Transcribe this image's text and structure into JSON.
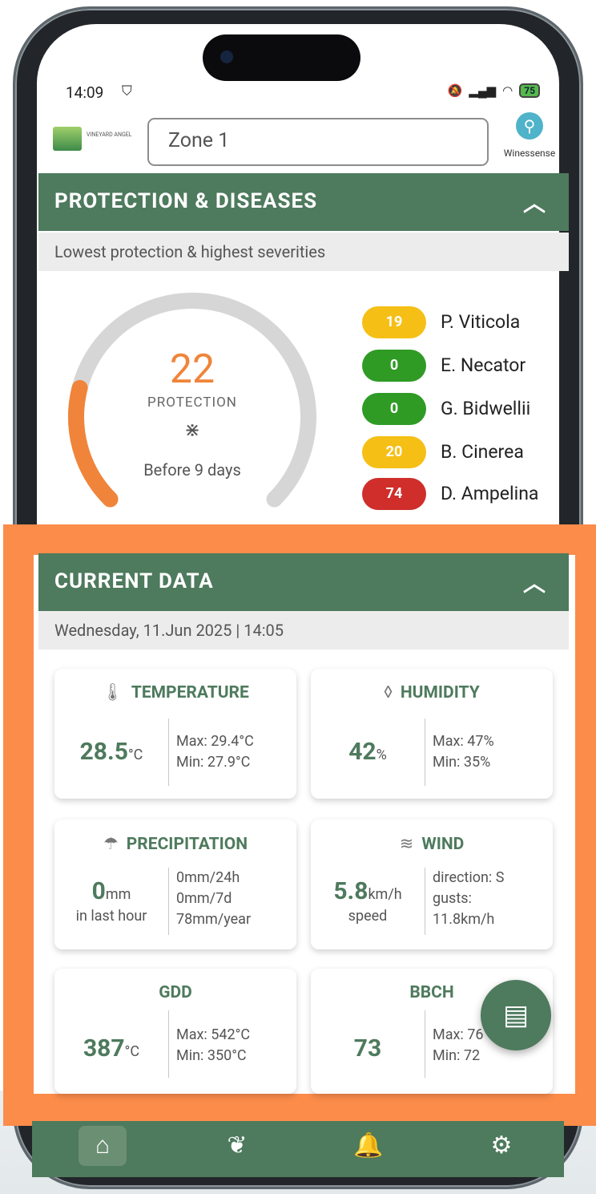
{
  "status": {
    "time": "14:09",
    "battery": "75"
  },
  "header": {
    "logo_text": "VINEYARD ANGEL",
    "zone": "Zone 1",
    "brand_label": "Winessense"
  },
  "protection": {
    "title": "PROTECTION & DISEASES",
    "subtitle": "Lowest protection & highest severities",
    "gauge": {
      "value": "22",
      "value_num": 22,
      "label": "PROTECTION",
      "time": "Before 9 days"
    },
    "diseases": [
      {
        "value": "19",
        "name": "P. Viticola",
        "color": "#f5bf15"
      },
      {
        "value": "0",
        "name": "E. Necator",
        "color": "#2f9b25"
      },
      {
        "value": "0",
        "name": "G. Bidwellii",
        "color": "#2f9b25"
      },
      {
        "value": "20",
        "name": "B. Cinerea",
        "color": "#f5bf15"
      },
      {
        "value": "74",
        "name": "D. Ampelina",
        "color": "#cf2e2b"
      }
    ]
  },
  "current": {
    "title": "CURRENT DATA",
    "date": "Wednesday, 11.Jun 2025 | 14:05",
    "cards": {
      "temperature": {
        "title": "TEMPERATURE",
        "value": "28.5",
        "unit": "°C",
        "max": "Max: 29.4°C",
        "min": "Min: 27.9°C"
      },
      "humidity": {
        "title": "HUMIDITY",
        "value": "42",
        "unit": "%",
        "max": "Max: 47%",
        "min": "Min: 35%"
      },
      "precipitation": {
        "title": "PRECIPITATION",
        "value": "0",
        "unit": "mm",
        "sub": "in last hour",
        "line1": "0mm/24h",
        "line2": "0mm/7d",
        "line3": "78mm/year"
      },
      "wind": {
        "title": "WIND",
        "value": "5.8",
        "unit": "km/h",
        "sub": "speed",
        "line1": "direction: S",
        "line2": "gusts:",
        "line3": "11.8km/h"
      },
      "gdd": {
        "title": "GDD",
        "value": "387",
        "unit": "°C",
        "max": "Max: 542°C",
        "min": "Min: 350°C"
      },
      "bbch": {
        "title": "BBCH",
        "value": "73",
        "max": "Max: 76",
        "min": "Min: 72"
      }
    }
  },
  "colors": {
    "brand_green": "#4e7a5d",
    "accent_orange": "#f0843a",
    "overlay_orange": "#fb8c4a"
  }
}
